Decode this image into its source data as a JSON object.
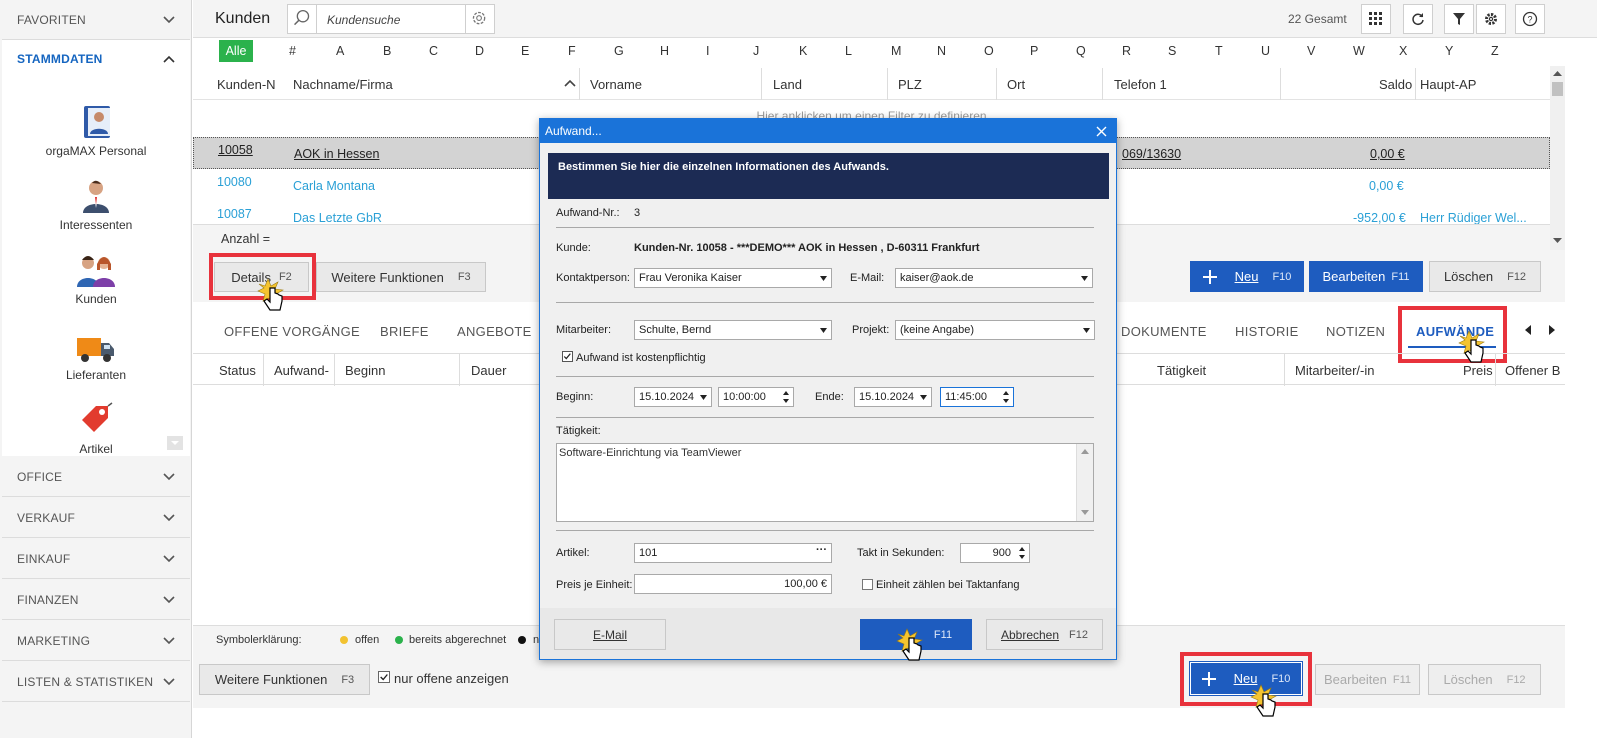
{
  "sidebar": {
    "favoriten": "FAVORITEN",
    "stammdaten": "STAMMDATEN",
    "items": [
      {
        "label": "orgaMAX Personal",
        "icon": "personnel-icon"
      },
      {
        "label": "Interessenten",
        "icon": "prospect-icon"
      },
      {
        "label": "Kunden",
        "icon": "customers-icon"
      },
      {
        "label": "Lieferanten",
        "icon": "truck-icon"
      },
      {
        "label": "Artikel",
        "icon": "tag-icon"
      }
    ],
    "sections": [
      "OFFICE",
      "VERKAUF",
      "EINKAUF",
      "FINANZEN",
      "MARKETING",
      "LISTEN & STATISTIKEN"
    ]
  },
  "header": {
    "title": "Kunden",
    "search_placeholder": "Kundensuche",
    "total": "22 Gesamt"
  },
  "alphabet": [
    "Alle",
    "#",
    "A",
    "B",
    "C",
    "D",
    "E",
    "F",
    "G",
    "H",
    "I",
    "J",
    "K",
    "L",
    "M",
    "N",
    "O",
    "P",
    "Q",
    "R",
    "S",
    "T",
    "U",
    "V",
    "W",
    "X",
    "Y",
    "Z"
  ],
  "grid": {
    "columns": [
      "Kunden-N",
      "Nachname/Firma",
      "Vorname",
      "Land",
      "PLZ",
      "Ort",
      "Telefon 1",
      "Saldo",
      "Haupt-AP"
    ],
    "filter_hint": "Hier anklicken um einen Filter zu definieren",
    "rows": [
      {
        "nr": "10058",
        "name": "AOK in Hessen",
        "phone": "069/13630",
        "saldo": "0,00 €",
        "ap": ""
      },
      {
        "nr": "10080",
        "name": "Carla Montana",
        "phone": "",
        "saldo": "0,00 €",
        "ap": ""
      },
      {
        "nr": "10087",
        "name": "Das Letzte GbR",
        "phone": "",
        "saldo": "-952,00 €",
        "ap": "Herr Rüdiger Wel..."
      }
    ],
    "count_label": "Anzahl ="
  },
  "mid_buttons": {
    "details": "Details",
    "details_key": "F2",
    "weitere": "Weitere Funktionen",
    "weitere_key": "F3",
    "neu": "Neu",
    "neu_key": "F10",
    "bearbeiten": "Bearbeiten",
    "bearbeiten_key": "F11",
    "loeschen": "Löschen",
    "loeschen_key": "F12"
  },
  "tabs": [
    "OFFENE VORGÄNGE",
    "BRIEFE",
    "ANGEBOTE",
    "DOKUMENTE",
    "HISTORIE",
    "NOTIZEN",
    "AUFWÄNDE"
  ],
  "sub_columns": [
    "Status",
    "Aufwand-",
    "Beginn",
    "Dauer",
    "Tätigkeit",
    "Mitarbeiter/-in",
    "Preis",
    "Offener B"
  ],
  "legend": {
    "label": "Symbolerklärung:",
    "items": [
      {
        "text": "offen",
        "color": "#f2c230"
      },
      {
        "text": "bereits abgerechnet",
        "color": "#2bb24c"
      },
      {
        "text": "n",
        "color": "#111111"
      }
    ]
  },
  "bottom": {
    "weitere": "Weitere Funktionen",
    "weitere_key": "F3",
    "checkbox": "nur offene anzeigen",
    "neu": "Neu",
    "neu_key": "F10",
    "bearbeiten": "Bearbeiten",
    "bearbeiten_key": "F11",
    "loeschen": "Löschen",
    "loeschen_key": "F12"
  },
  "dialog": {
    "title": "Aufwand...",
    "banner": "Bestimmen Sie hier die einzelnen Informationen des Aufwands.",
    "nr_label": "Aufwand-Nr.:",
    "nr": "3",
    "kunde_label": "Kunde:",
    "kunde": "Kunden-Nr. 10058 - ***DEMO*** AOK in Hessen , D-60311  Frankfurt",
    "kontakt_label": "Kontaktperson:",
    "kontakt": "Frau Veronika Kaiser",
    "email_label": "E-Mail:",
    "email": "kaiser@aok.de",
    "mitarbeiter_label": "Mitarbeiter:",
    "mitarbeiter": "Schulte, Bernd",
    "projekt_label": "Projekt:",
    "projekt": "(keine Angabe)",
    "kostenpflichtig": "Aufwand ist kostenpflichtig",
    "beginn_label": "Beginn:",
    "beginn_date": "15.10.2024",
    "beginn_time": "10:00:00",
    "ende_label": "Ende:",
    "ende_date": "15.10.2024",
    "ende_time": "11:45:00",
    "taetigkeit_label": "Tätigkeit:",
    "taetigkeit": "Software-Einrichtung via TeamViewer",
    "artikel_label": "Artikel:",
    "artikel": "101",
    "takt_label": "Takt in Sekunden:",
    "takt": "900",
    "preis_label": "Preis je Einheit:",
    "preis": "100,00 €",
    "einheit_label": "Einheit zählen bei Taktanfang",
    "email_btn": "E-Mail",
    "ok_key": "F11",
    "abbrechen": "Abbrechen",
    "abbrechen_key": "F12"
  },
  "colors": {
    "accent": "#1e5cbf",
    "highlight": "#e8323c",
    "link": "#2aa0d6",
    "banner": "#1c2b54"
  }
}
